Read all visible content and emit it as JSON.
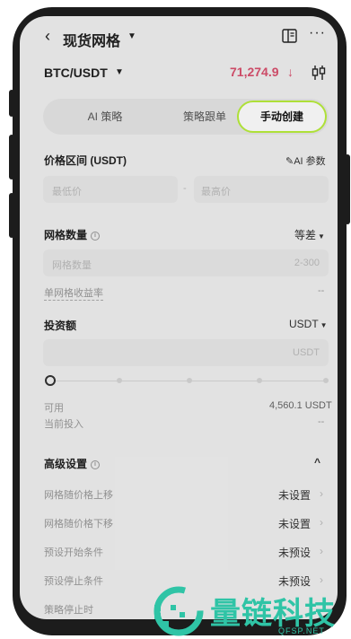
{
  "header": {
    "back_icon": "chevron-left-icon",
    "title": "现货网格",
    "title_caret": "▼",
    "book_icon": "book-icon",
    "more_icon": "more-icon",
    "more_glyph": "···"
  },
  "pair": {
    "symbol": "BTC/USDT",
    "caret": "▼",
    "price": "71,274.9",
    "price_arrow": "↓",
    "price_color": "#d9506e",
    "chart_icon": "candlestick-icon"
  },
  "tabs": [
    {
      "label": "AI 策略",
      "active": false
    },
    {
      "label": "策略跟单",
      "active": false
    },
    {
      "label": "手动创建",
      "active": true
    }
  ],
  "accent_color": "#b9ef3c",
  "form": {
    "price_range": {
      "label": "价格区间 (USDT)",
      "ai_params_label": "AI 参数",
      "min_placeholder": "最低价",
      "separator": "-",
      "max_placeholder": "最高价"
    },
    "grid_count": {
      "label": "网格数量",
      "mode": "等差",
      "placeholder": "网格数量",
      "range_hint": "2-300"
    },
    "yield_per_grid": {
      "label": "单网格收益率",
      "value": "--"
    },
    "investment": {
      "label": "投资额",
      "currency": "USDT",
      "input_suffix": "USDT",
      "slider_percent": 0
    },
    "available": {
      "label": "可用",
      "value": "4,560.1 USDT"
    },
    "current_input": {
      "label": "当前投入",
      "value": "--"
    },
    "advanced": {
      "label": "高级设置",
      "toggle": "^",
      "rows": [
        {
          "label": "网格随价格上移",
          "value": "未设置"
        },
        {
          "label": "网格随价格下移",
          "value": "未设置"
        },
        {
          "label": "预设开始条件",
          "value": "未预设"
        },
        {
          "label": "预设停止条件",
          "value": "未预设"
        },
        {
          "label": "策略停止时",
          "value": ""
        }
      ]
    }
  },
  "watermark": {
    "text": "量链科技",
    "sub": "QFSP.NET"
  }
}
